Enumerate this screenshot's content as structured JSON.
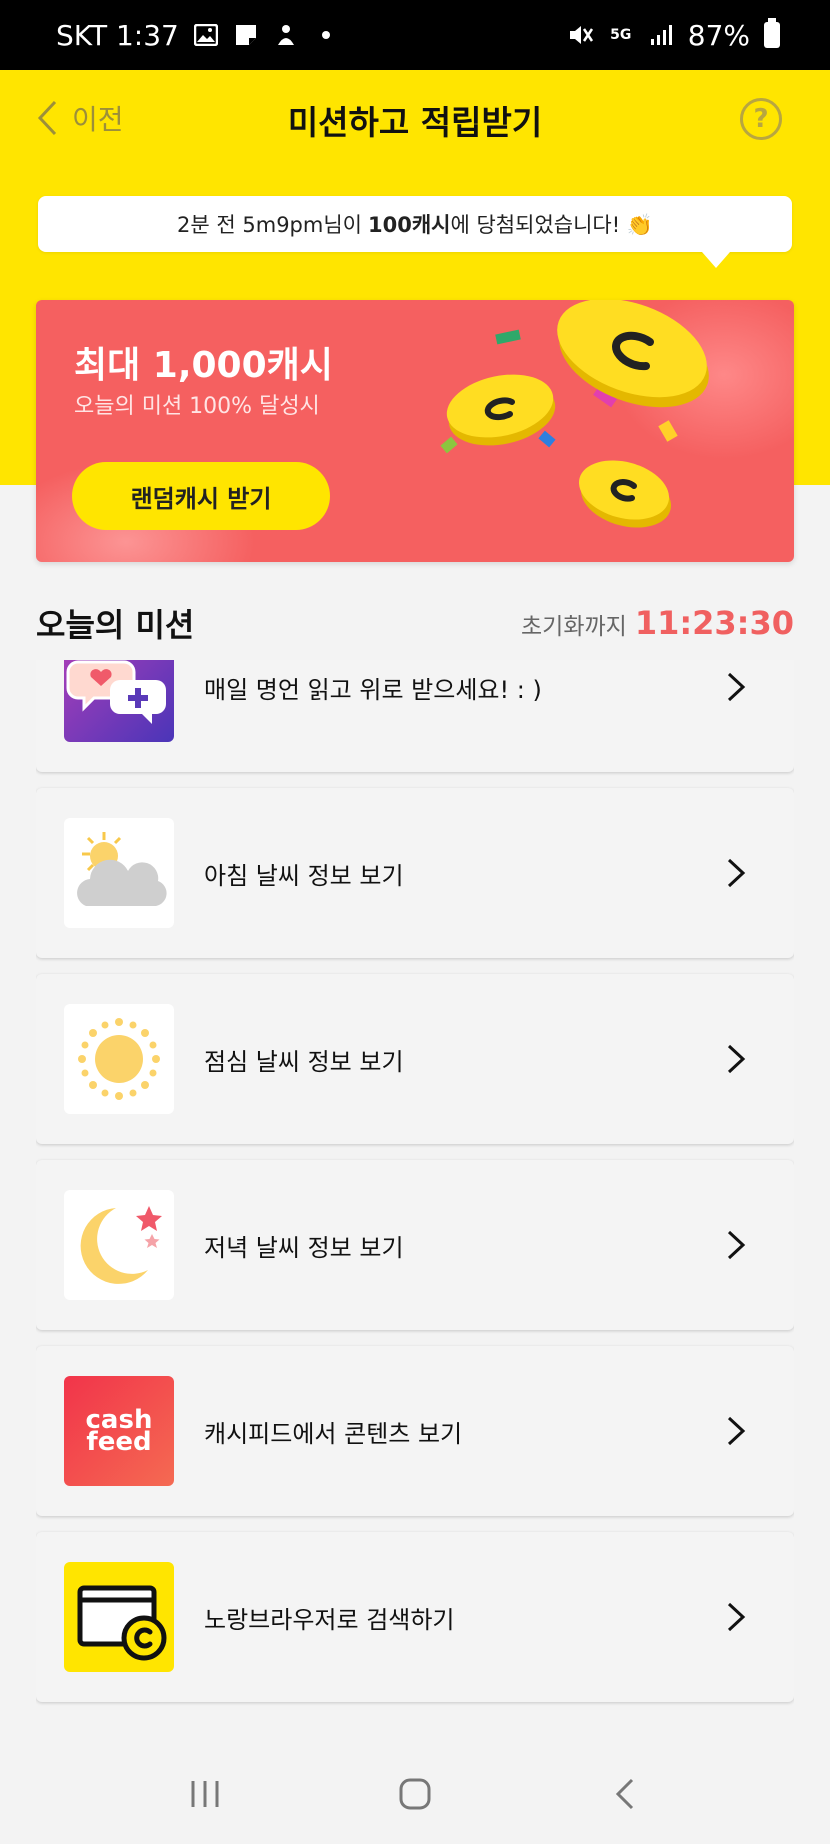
{
  "status_bar": {
    "carrier_time": "SKT 1:37",
    "battery": "87%",
    "icons": [
      "image-icon",
      "note-icon",
      "notification-icon",
      "dot-icon",
      "mute-icon",
      "5g-icon",
      "signal-icon",
      "battery-icon"
    ]
  },
  "nav": {
    "back_label": "이전",
    "title": "미션하고 적립받기",
    "help_label": "?"
  },
  "ticker": {
    "prefix": "2분 전 5m9pm님이",
    "amount": "100캐시",
    "suffix": "에 당첨되었습니다! 👏"
  },
  "banner": {
    "title": "최대 1,000캐시",
    "subtitle": "오늘의 미션 100% 달성시",
    "button_label": "랜덤캐시 받기"
  },
  "missions_header": {
    "title": "오늘의 미션",
    "reset_label": "초기화까지",
    "reset_time": "11:23:30"
  },
  "missions": [
    {
      "label": "매일 명언 읽고 위로 받으세요! : )",
      "icon": "chat-heart-icon"
    },
    {
      "label": "아침 날씨 정보 보기",
      "icon": "cloud-sun-icon"
    },
    {
      "label": "점심 날씨 정보 보기",
      "icon": "sun-icon"
    },
    {
      "label": "저녁 날씨 정보 보기",
      "icon": "moon-icon"
    },
    {
      "label": "캐시피드에서 콘텐츠 보기",
      "icon": "cashfeed-logo-icon",
      "logo_text": [
        "cash",
        "feed"
      ]
    },
    {
      "label": "노랑브라우저로 검색하기",
      "icon": "browser-coin-icon"
    }
  ],
  "colors": {
    "header_yellow": "#ffe500",
    "banner_red": "#f56060",
    "timer_red": "#f06060"
  }
}
